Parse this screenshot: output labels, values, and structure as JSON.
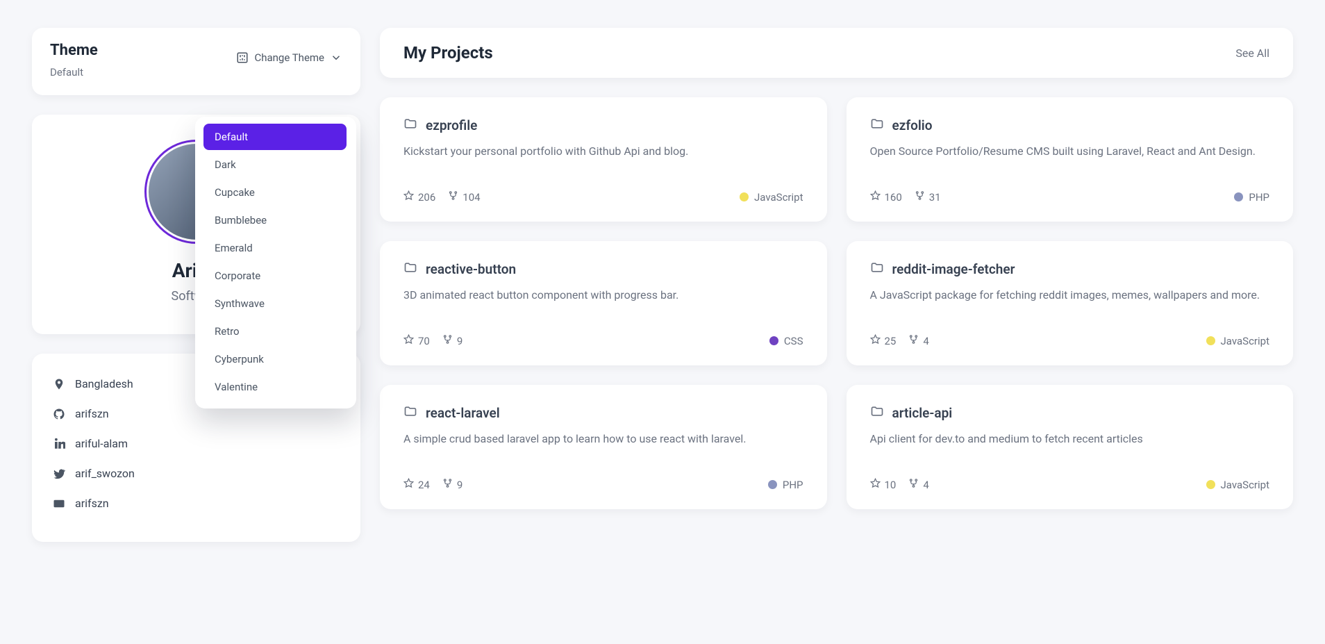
{
  "theme": {
    "title": "Theme",
    "current": "Default",
    "change_label": "Change Theme",
    "options": [
      "Default",
      "Dark",
      "Cupcake",
      "Bumblebee",
      "Emerald",
      "Corporate",
      "Synthwave",
      "Retro",
      "Cyberpunk",
      "Valentine"
    ]
  },
  "profile": {
    "name": "Ariful",
    "role": "Software"
  },
  "info": {
    "location": "Bangladesh",
    "github": "arifszn",
    "linkedin": "ariful-alam",
    "twitter": "arif_swozon",
    "devto": "arifszn"
  },
  "projects_header": {
    "title": "My Projects",
    "see_all": "See All"
  },
  "lang_colors": {
    "JavaScript": "#f1e05a",
    "PHP": "#8993be",
    "CSS": "#6f42c1"
  },
  "projects": [
    {
      "name": "ezprofile",
      "desc": "Kickstart your personal portfolio with Github Api and blog.",
      "stars": "206",
      "forks": "104",
      "lang": "JavaScript"
    },
    {
      "name": "ezfolio",
      "desc": "Open Source Portfolio/Resume CMS built using Laravel, React and Ant Design.",
      "stars": "160",
      "forks": "31",
      "lang": "PHP"
    },
    {
      "name": "reactive-button",
      "desc": "3D animated react button component with progress bar.",
      "stars": "70",
      "forks": "9",
      "lang": "CSS"
    },
    {
      "name": "reddit-image-fetcher",
      "desc": "A JavaScript package for fetching reddit images, memes, wallpapers and more.",
      "stars": "25",
      "forks": "4",
      "lang": "JavaScript"
    },
    {
      "name": "react-laravel",
      "desc": "A simple crud based laravel app to learn how to use react with laravel.",
      "stars": "24",
      "forks": "9",
      "lang": "PHP"
    },
    {
      "name": "article-api",
      "desc": "Api client for dev.to and medium to fetch recent articles",
      "stars": "10",
      "forks": "4",
      "lang": "JavaScript"
    }
  ]
}
